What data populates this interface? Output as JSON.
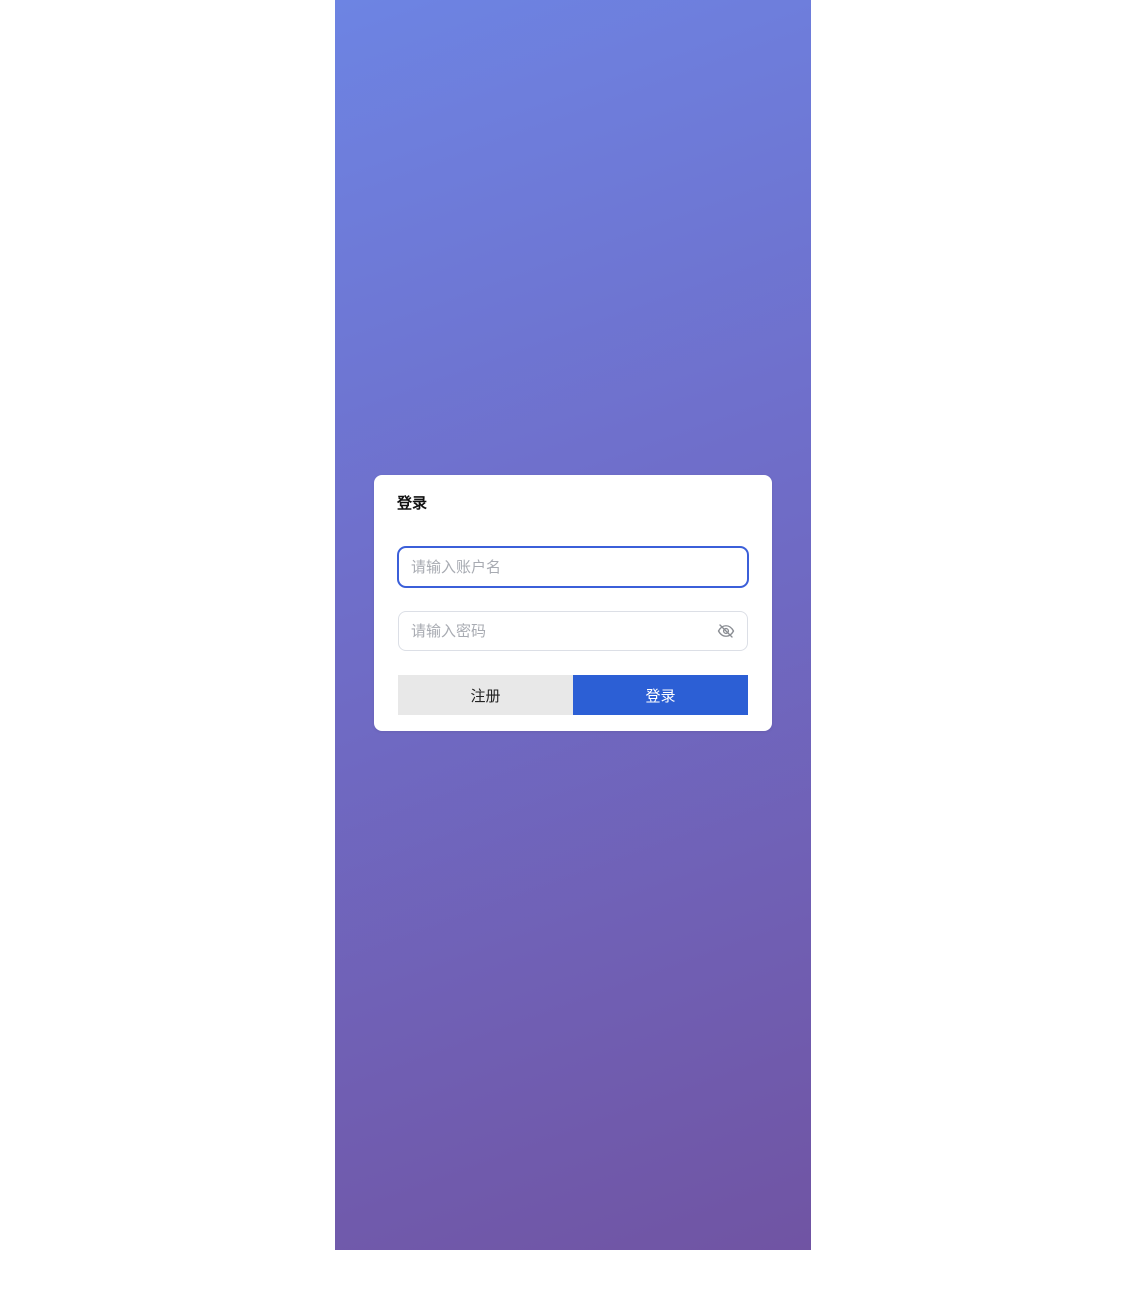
{
  "login_card": {
    "title": "登录",
    "username_placeholder": "请输入账户名",
    "password_placeholder": "请输入密码",
    "register_label": "注册",
    "login_label": "登录"
  },
  "icons": {
    "password_toggle": "eye-off-icon"
  },
  "colors": {
    "gradient_start": "#6d84e3",
    "gradient_end": "#7054a3",
    "primary_button": "#2c5fd5",
    "secondary_button": "#e8e8e8",
    "focus_border": "#3b5fd9"
  }
}
